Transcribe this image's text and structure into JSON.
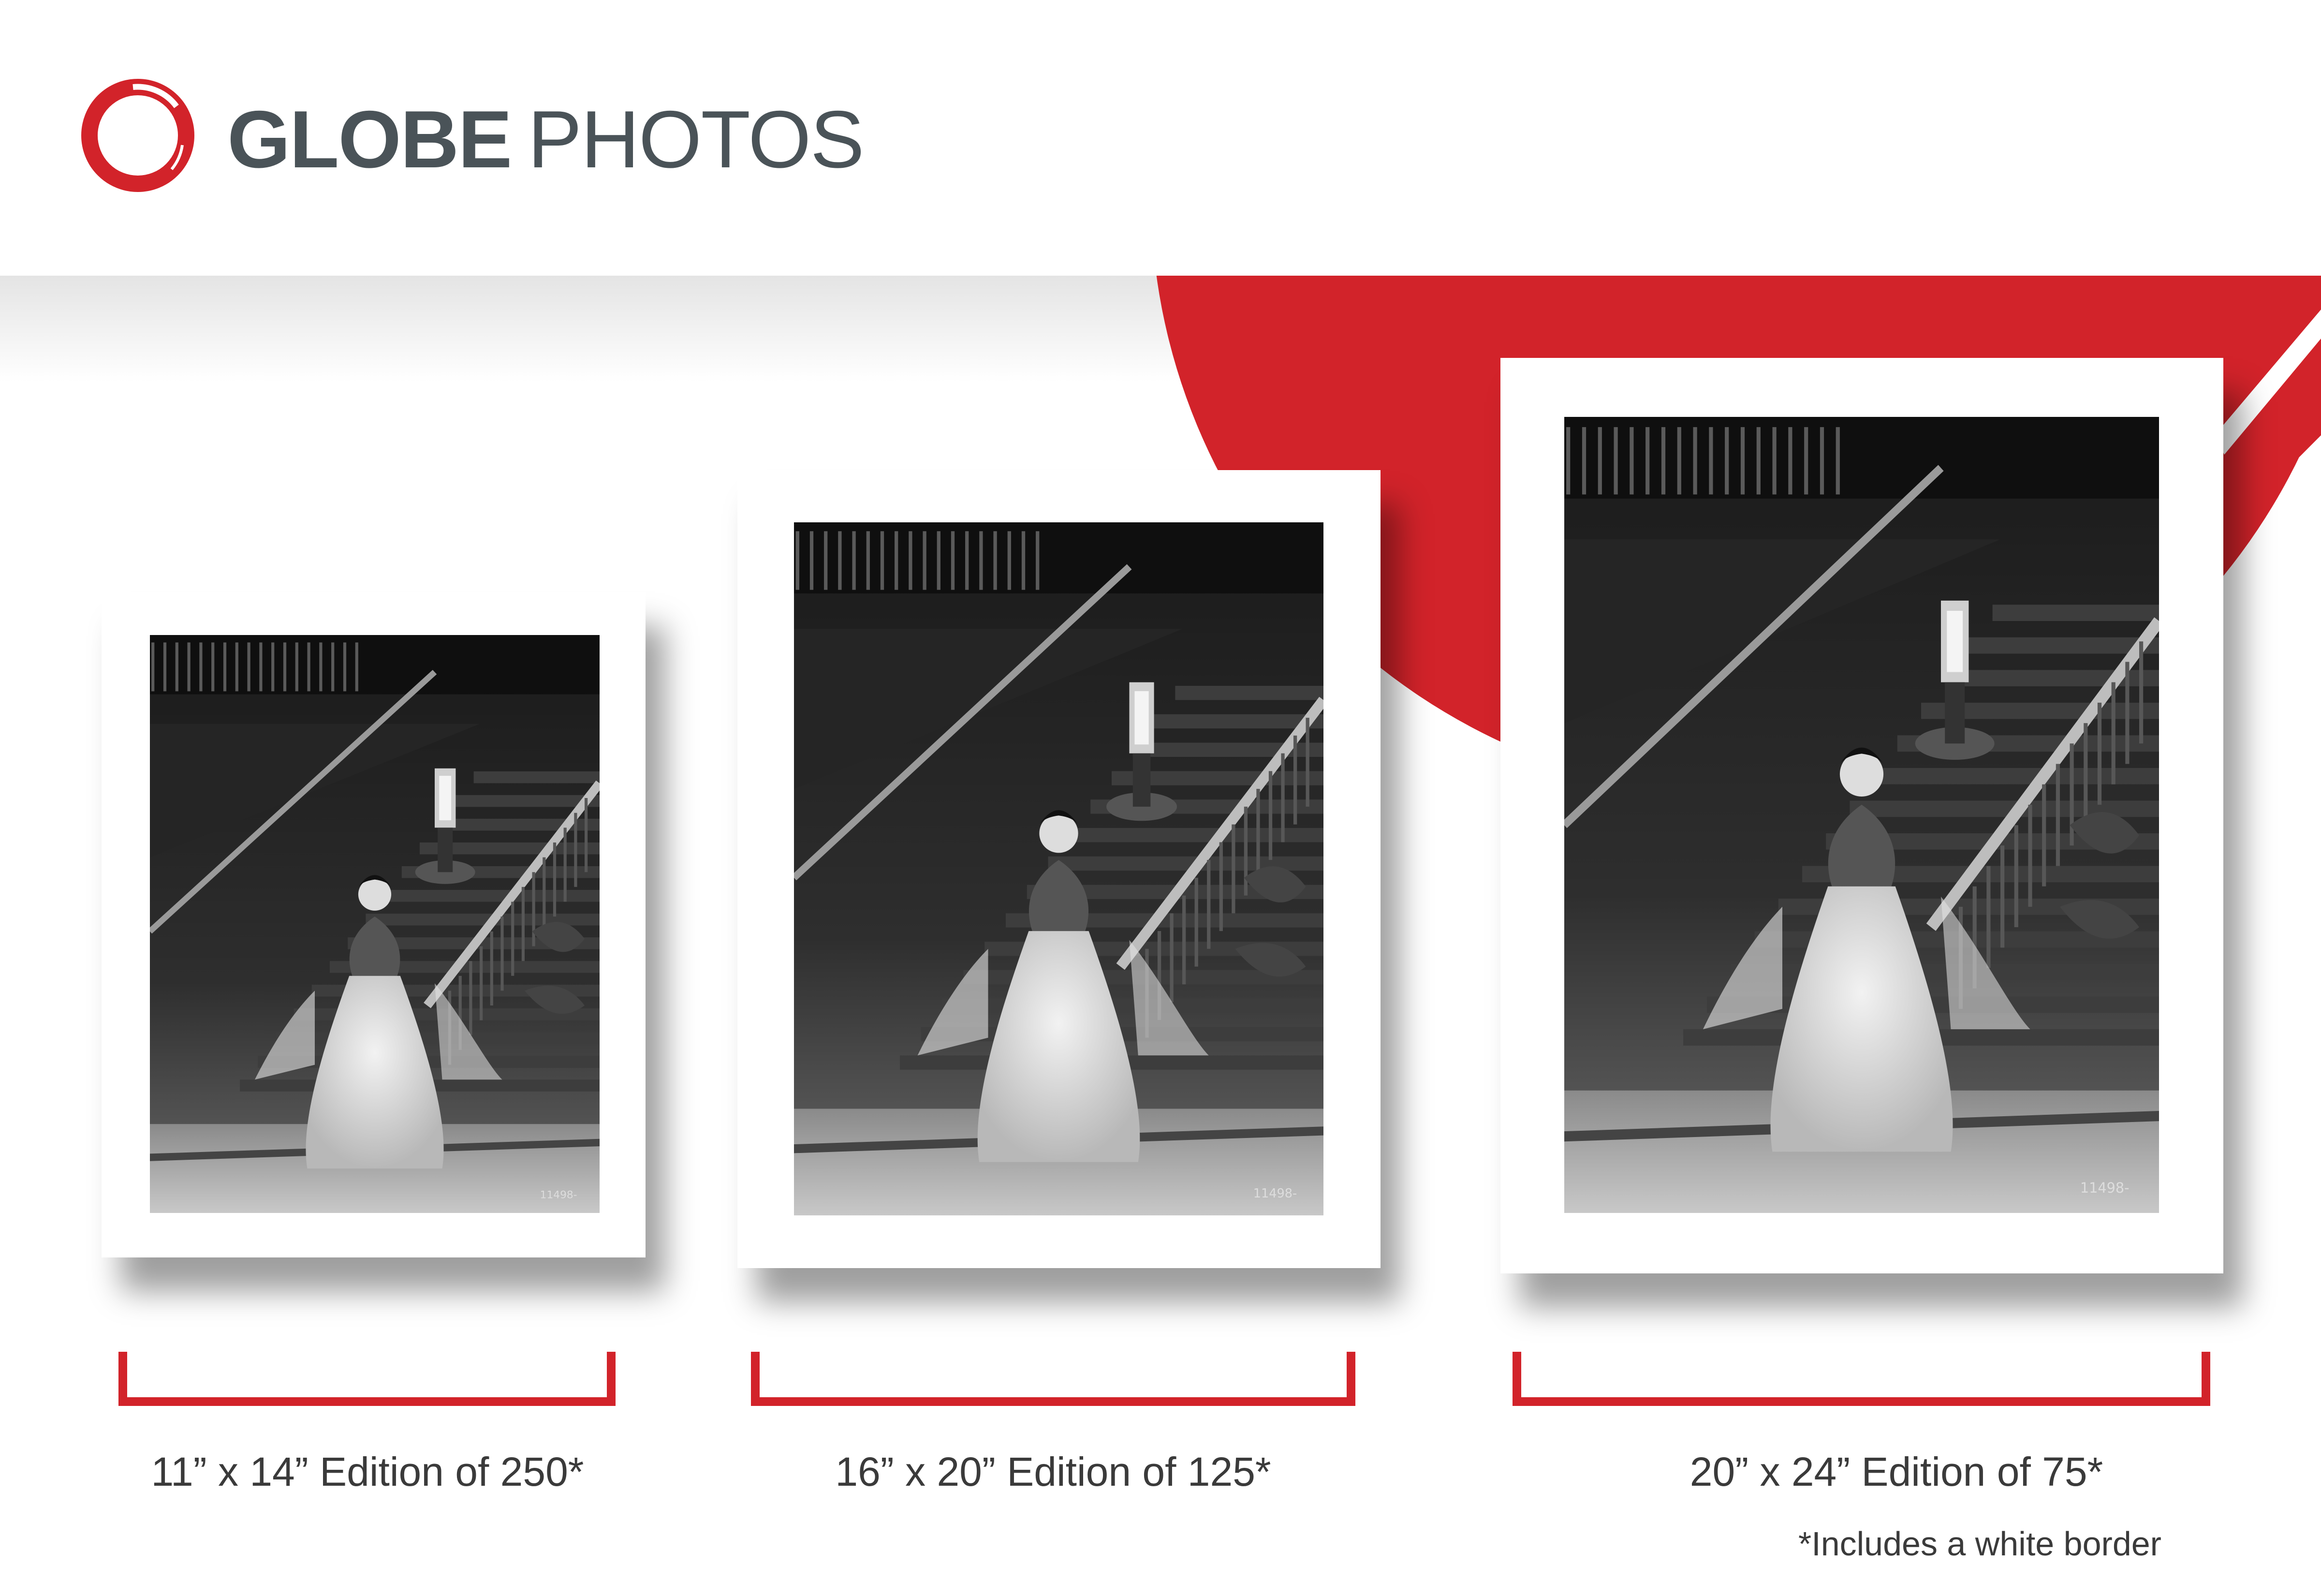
{
  "brand": {
    "name_bold": "GLOBE",
    "name_light": "PHOTOS",
    "accent": "#d2232a",
    "text_color": "#4a5358"
  },
  "prints": [
    {
      "size": "11” x 14”",
      "edition": "Edition of 250*",
      "label": "11” x 14” Edition of 250*"
    },
    {
      "size": "16” x 20”",
      "edition": "Edition of 125*",
      "label": "16” x 20” Edition of 125*"
    },
    {
      "size": "20” x 24”",
      "edition": "Edition of 75*",
      "label": "20” x 24” Edition of 75*"
    }
  ],
  "photo_caption_number": "11498-",
  "footnote": "*Includes a white border"
}
